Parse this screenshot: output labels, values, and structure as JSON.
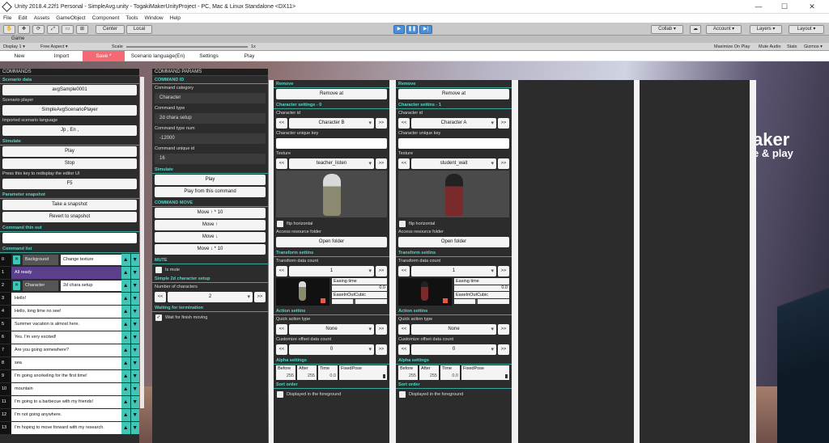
{
  "window": {
    "title": "Unity 2018.4.22f1 Personal - SimpleAvg.unity - TogakiMakerUnityProject - PC, Mac & Linux Standalone <DX11>",
    "min": "—",
    "max": "☐",
    "close": "✕"
  },
  "menu": [
    "File",
    "Edit",
    "Assets",
    "GameObject",
    "Component",
    "Tools",
    "Window",
    "Help"
  ],
  "toolbar": {
    "center": "Center",
    "local": "Local",
    "collab": "Collab ▾",
    "account": "Account ▾",
    "layers": "Layers ▾",
    "layout": "Layout ▾",
    "tools": [
      "✋",
      "✥",
      "⟳",
      "⤢",
      "▭",
      "⊞"
    ],
    "play": "▶",
    "pause": "❚❚",
    "step": "▶|",
    "cloud": "☁"
  },
  "game": {
    "tab": "Game",
    "display": "Display 1 ▾",
    "aspect": "Free Aspect ▾",
    "scale_label": "Scale",
    "scale_val": "1x",
    "maximize": "Maximize On Play",
    "mute": "Mute Audio",
    "stats": "Stats",
    "gizmos": "Gizmos ▾"
  },
  "tabs": [
    "New",
    "Import",
    "Save *",
    "Scenario language(En)",
    "Settings",
    "Play"
  ],
  "scene": {
    "text1": "aker",
    "text2": "e & play"
  },
  "commands": {
    "header": "COMMANDS",
    "scenario_data": "Scenario data",
    "sample": "avgSample0001",
    "player_label": "Scenario player",
    "player": "SimpleAvgScenarioPlayer",
    "lang_label": "Imported scenario language",
    "lang": "Jp , En ,",
    "simulate": "Simulate",
    "play": "Play",
    "stop": "Stop",
    "press": "Press this key to redisplay the editor UI",
    "key": "F5",
    "snapshot": "Parameter snapshot",
    "take": "Take a snapshot",
    "revert": "Revert to snapshot",
    "thinout": "Command thin out",
    "list": "Command list",
    "rows": [
      {
        "n": "0",
        "x": "✕",
        "a": "Background",
        "b": "Change texture",
        "kind": "two"
      },
      {
        "n": "1",
        "a": "All ready",
        "kind": "purple"
      },
      {
        "n": "2",
        "x": "✕",
        "a": "Character",
        "b": "2d chara setup",
        "kind": "two"
      },
      {
        "n": "3",
        "a": "Hello!",
        "kind": "one"
      },
      {
        "n": "4",
        "a": "Hello, long time no see!",
        "kind": "one"
      },
      {
        "n": "5",
        "a": "Summer vacation is almost here.",
        "kind": "one"
      },
      {
        "n": "6",
        "a": "Yes. I'm very excited!",
        "kind": "one"
      },
      {
        "n": "7",
        "a": "Are you going somewhere?",
        "kind": "one"
      },
      {
        "n": "8",
        "a": "sea",
        "kind": "one"
      },
      {
        "n": "9",
        "a": "I'm going snorkeling for the first time!",
        "kind": "one"
      },
      {
        "n": "10",
        "a": "mountain",
        "kind": "one"
      },
      {
        "n": "11",
        "a": "I'm going to a barbecue with my friends!",
        "kind": "one"
      },
      {
        "n": "12",
        "a": "I'm not going anywhere.",
        "kind": "one"
      },
      {
        "n": "13",
        "a": "I'm hoping to move forward with my research.",
        "kind": "one"
      }
    ],
    "up": "▲",
    "down": "▼"
  },
  "params": {
    "header": "COMMAND PARAMS",
    "cmd_id": "COMMAND ID",
    "cat_label": "Command category",
    "cat": "Character",
    "type_label": "Command type",
    "type": "2d chara setup",
    "num_label": "Command type num",
    "num": "-12000",
    "uid_label": "Command unique id",
    "uid": "16",
    "simulate": "Simulate",
    "play": "Play",
    "play_from": "Play from this command",
    "move": "COMMAND MOVE",
    "m1": "Move ↑ * 10",
    "m2": "Move ↑",
    "m3": "Move ↓",
    "m4": "Move ↓ * 10",
    "mute": "MUTE",
    "is_mute": "Is mute",
    "setup": "Simple 2d character setup",
    "num_chars_label": "Number of characters",
    "num_chars": "2",
    "prev": "<<",
    "next": ">>",
    "wait": "Waiting for termination",
    "wait_finish": "Wait for finish moving",
    "check": "✓"
  },
  "charA": {
    "remove": "Remove",
    "remove_at": "Remove at",
    "settings": "Character settings - 0",
    "id_label": "Character id",
    "id": "Character B",
    "key_label": "Character unique key",
    "tex_label": "Texture",
    "tex": "teacher_listen",
    "flip": "flip horizontal",
    "access": "Access resource folder",
    "open": "Open folder",
    "transform": "Transform settins",
    "tcount_label": "Transform data count",
    "tcount": "1",
    "ease_time": "Easing time",
    "ease_val": "0.0",
    "ease_fn": "EaseInOutCubic",
    "action": "Action settins",
    "quick_label": "Quick action type",
    "quick": "None",
    "offset_label": "Customize offset data count",
    "offset": "0",
    "alpha": "Alpha settings",
    "before": "Before",
    "after": "After",
    "time": "Time",
    "fixed": "FixedPose",
    "bv": "255",
    "av": "255",
    "tv": "0.0",
    "sort": "Sort order",
    "fore": "Displayed in the foreground",
    "prev": "<<",
    "next": ">>"
  },
  "charB": {
    "remove": "Remove",
    "remove_at": "Remove at",
    "settings": "Character settins - 1",
    "id_label": "Character id",
    "id": "Character A",
    "key_label": "Character unique key",
    "tex_label": "Texture",
    "tex": "student_wait",
    "flip": "flip horizontal",
    "access": "Access resource folder",
    "open": "Open folder",
    "transform": "Transform settins",
    "tcount_label": "Transform data count",
    "tcount": "1",
    "ease_time": "Easing time",
    "ease_val": "0.0",
    "ease_fn": "EaseInOutCubic",
    "action": "Action settins",
    "quick_label": "Quick action type",
    "quick": "None",
    "offset_label": "Customize offset data count",
    "offset": "0",
    "alpha": "Alpha settings",
    "before": "Before",
    "after": "After",
    "time": "Time",
    "fixed": "FixedPose",
    "bv": "255",
    "av": "255",
    "tv": "0.0",
    "sort": "Sort order",
    "fore": "Displayed in the foreground",
    "prev": "<<",
    "next": ">>"
  }
}
